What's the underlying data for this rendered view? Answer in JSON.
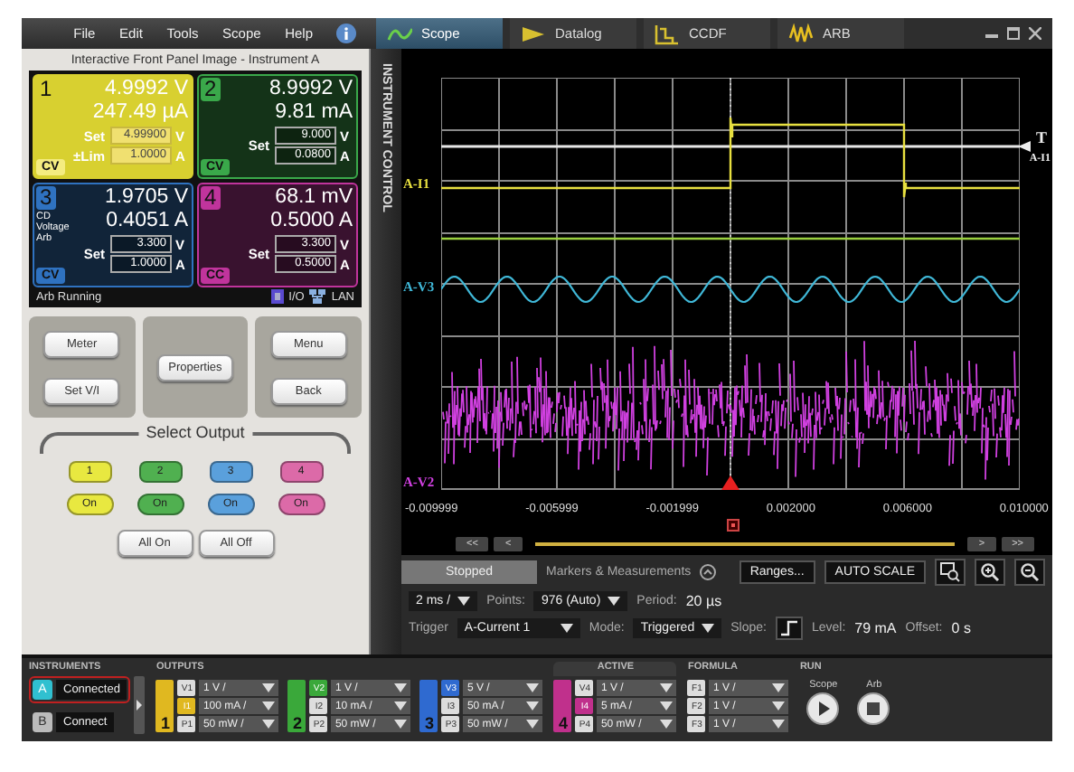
{
  "menu": [
    "File",
    "Edit",
    "Tools",
    "Scope",
    "Help"
  ],
  "tabs": [
    {
      "label": "Scope",
      "selected": true
    },
    {
      "label": "Datalog",
      "selected": false
    },
    {
      "label": "CCDF",
      "selected": false
    },
    {
      "label": "ARB",
      "selected": false
    }
  ],
  "front_panel": {
    "title": "Interactive Front Panel Image - Instrument A",
    "channels": [
      {
        "number": "1",
        "color": "#d8d030",
        "selected": true,
        "readings": [
          "4.9992 V",
          "247.49 µA"
        ],
        "set_label": "Set",
        "settings": [
          {
            "value": "4.99900",
            "unit": "V"
          }
        ],
        "limit": {
          "label": "±Lim",
          "value": "1.0000",
          "unit": "A"
        },
        "mode": "CV"
      },
      {
        "number": "2",
        "color": "#3aa84a",
        "selected": false,
        "readings": [
          "8.9992 V",
          "9.81 mA"
        ],
        "set_label": "Set",
        "settings": [
          {
            "value": "9.000",
            "unit": "V"
          },
          {
            "value": "0.0800",
            "unit": "A"
          }
        ],
        "mode": "CV"
      },
      {
        "number": "3",
        "color": "#2f72c0",
        "selected": false,
        "note": "CD Voltage Arb",
        "readings": [
          "1.9705 V",
          "0.4051 A"
        ],
        "set_label": "Set",
        "settings": [
          {
            "value": "3.300",
            "unit": "V"
          },
          {
            "value": "1.0000",
            "unit": "A"
          }
        ],
        "mode": "CV"
      },
      {
        "number": "4",
        "color": "#c0349c",
        "selected": false,
        "readings": [
          "68.1 mV",
          "0.5000 A"
        ],
        "set_label": "Set",
        "settings": [
          {
            "value": "3.300",
            "unit": "V"
          },
          {
            "value": "0.5000",
            "unit": "A"
          }
        ],
        "mode": "CC"
      }
    ],
    "status": "Arb Running",
    "io": "I/O",
    "lan": "LAN",
    "button_groups": [
      [
        "Meter",
        "Set V/I"
      ],
      [
        "Properties"
      ],
      [
        "Menu",
        "Back"
      ]
    ],
    "select_output": {
      "title": "Select Output",
      "outputs": [
        {
          "number": "1",
          "on_label": "On",
          "color": "#e8e840"
        },
        {
          "number": "2",
          "on_label": "On",
          "color": "#50b050"
        },
        {
          "number": "3",
          "on_label": "On",
          "color": "#5aa0dc"
        },
        {
          "number": "4",
          "on_label": "On",
          "color": "#dc6aa8"
        }
      ],
      "all_on": "All On",
      "all_off": "All Off"
    }
  },
  "side_label": "INSTRUMENT CONTROL",
  "scope": {
    "trace_labels": [
      {
        "label": "A-I1",
        "color": "#e8e040"
      },
      {
        "label": "A-V3",
        "color": "#40b8d8"
      },
      {
        "label": "A-V2",
        "color": "#d040e0"
      }
    ],
    "trigger_mark": "T",
    "trigger_trace": "A-I1",
    "x_ticks": [
      "-0.009999",
      "-0.005999",
      "-0.001999",
      "0.002000",
      "0.006000",
      "0.010000"
    ],
    "nav": [
      "<<",
      "<",
      ">",
      ">>"
    ],
    "status": "Stopped",
    "markers": "Markers & Measurements",
    "ranges": "Ranges...",
    "auto_scale": "AUTO SCALE",
    "timebase": "2 ms /",
    "points_label": "Points:",
    "points": "976 (Auto)",
    "period_label": "Period:",
    "period": "20 µs",
    "trigger": {
      "label": "Trigger",
      "source": "A-Current 1",
      "mode_label": "Mode:",
      "mode": "Triggered",
      "slope_label": "Slope:",
      "level_label": "Level:",
      "level_reading": "79 mA",
      "offset_label": "Offset:",
      "offset": "0 s"
    }
  },
  "bottom": {
    "instruments": {
      "title": "INSTRUMENTS",
      "items": [
        {
          "letter": "A",
          "label": "Connected",
          "selected": true
        },
        {
          "letter": "B",
          "label": "Connect",
          "selected": false
        }
      ]
    },
    "outputs": {
      "title": "OUTPUTS",
      "groups": [
        {
          "number": "1",
          "color": "#e0b820",
          "rows": [
            {
              "tag": "V1",
              "scale": "1 V /",
              "active": false
            },
            {
              "tag": "I1",
              "scale": "100 mA /",
              "active": true
            },
            {
              "tag": "P1",
              "scale": "50 mW /",
              "active": false
            }
          ]
        },
        {
          "number": "2",
          "color": "#3aa83a",
          "rows": [
            {
              "tag": "V2",
              "scale": "1 V /",
              "active": true
            },
            {
              "tag": "I2",
              "scale": "10 mA /",
              "active": false
            },
            {
              "tag": "P2",
              "scale": "50 mW /",
              "active": false
            }
          ]
        },
        {
          "number": "3",
          "color": "#2f6ad0",
          "rows": [
            {
              "tag": "V3",
              "scale": "5 V /",
              "active": true
            },
            {
              "tag": "I3",
              "scale": "50 mA /",
              "active": false
            },
            {
              "tag": "P3",
              "scale": "50 mW /",
              "active": false
            }
          ]
        }
      ]
    },
    "active": {
      "title": "ACTIVE",
      "groups": [
        {
          "number": "4",
          "color": "#c0308c",
          "rows": [
            {
              "tag": "V4",
              "scale": "1 V /",
              "active": false
            },
            {
              "tag": "I4",
              "scale": "5 mA /",
              "active": true
            },
            {
              "tag": "P4",
              "scale": "50 mW /",
              "active": false
            }
          ]
        }
      ]
    },
    "formula": {
      "title": "FORMULA",
      "rows": [
        {
          "tag": "F1",
          "scale": "1 V /"
        },
        {
          "tag": "F2",
          "scale": "1 V /"
        },
        {
          "tag": "F3",
          "scale": "1 V /"
        }
      ]
    },
    "run": {
      "title": "RUN",
      "buttons": [
        {
          "label": "Scope",
          "kind": "play"
        },
        {
          "label": "Arb",
          "kind": "stop"
        }
      ]
    }
  }
}
